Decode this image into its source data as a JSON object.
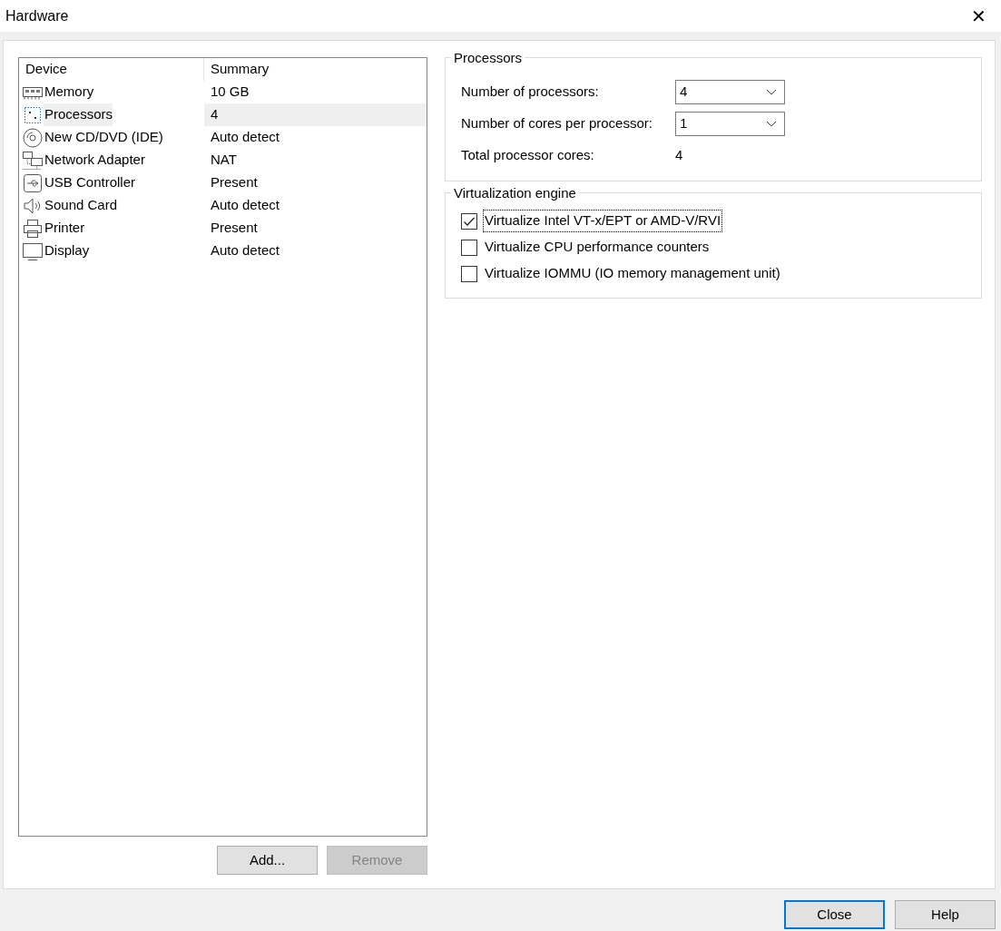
{
  "window": {
    "title": "Hardware",
    "close_glyph": "✕"
  },
  "device_list": {
    "columns": [
      "Device",
      "Summary"
    ],
    "rows": [
      {
        "device": "Memory",
        "summary": "10 GB",
        "selected": false
      },
      {
        "device": "Processors",
        "summary": "4",
        "selected": true
      },
      {
        "device": "New CD/DVD (IDE)",
        "summary": "Auto detect",
        "selected": false
      },
      {
        "device": "Network Adapter",
        "summary": "NAT",
        "selected": false
      },
      {
        "device": "USB Controller",
        "summary": "Present",
        "selected": false
      },
      {
        "device": "Sound Card",
        "summary": "Auto detect",
        "selected": false
      },
      {
        "device": "Printer",
        "summary": "Present",
        "selected": false
      },
      {
        "device": "Display",
        "summary": "Auto detect",
        "selected": false
      }
    ]
  },
  "list_buttons": [
    {
      "label": "Add...",
      "disabled": false
    },
    {
      "label": "Remove",
      "disabled": true
    }
  ],
  "processors": {
    "title": "Processors",
    "fields": [
      {
        "kind": "select",
        "label": "Number of processors:",
        "value": "4"
      },
      {
        "kind": "select",
        "label": "Number of cores per processor:",
        "value": "1"
      },
      {
        "kind": "readout",
        "label": "Total processor cores:",
        "value": "4"
      }
    ]
  },
  "virtualization": {
    "title": "Virtualization engine",
    "options": [
      {
        "label": "Virtualize Intel VT-x/EPT or AMD-V/RVI",
        "checked": true,
        "focused": true
      },
      {
        "label": "Virtualize CPU performance counters",
        "checked": false,
        "focused": false
      },
      {
        "label": "Virtualize IOMMU (IO memory management unit)",
        "checked": false,
        "focused": false
      }
    ]
  },
  "footer_buttons": [
    {
      "label": "Close",
      "default": true
    },
    {
      "label": "Help",
      "default": false
    }
  ]
}
